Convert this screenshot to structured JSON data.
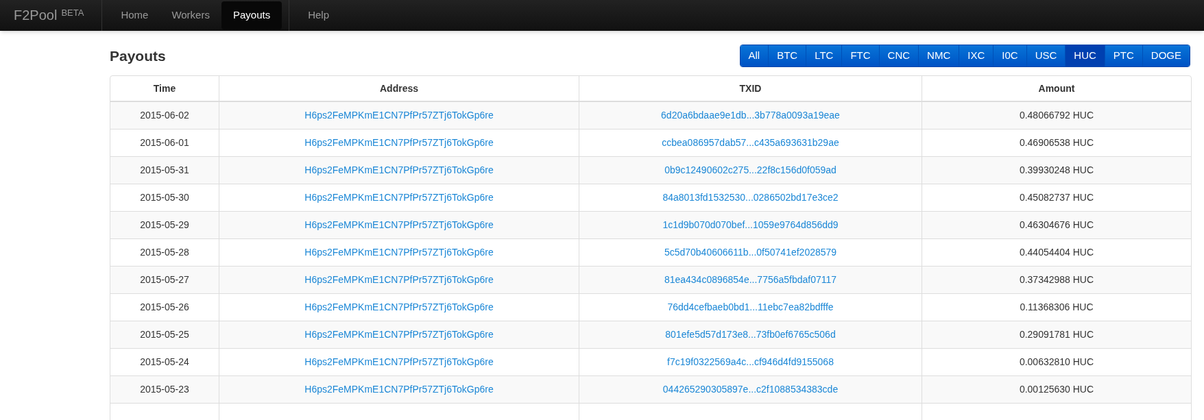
{
  "navbar": {
    "brand": "F2Pool",
    "brand_badge": "BETA",
    "groups": [
      {
        "items": [
          {
            "label": "Home",
            "selected": false
          },
          {
            "label": "Workers",
            "selected": false
          },
          {
            "label": "Payouts",
            "selected": true
          }
        ]
      },
      {
        "items": [
          {
            "label": "Help",
            "selected": false
          }
        ]
      }
    ]
  },
  "page_title": "Payouts",
  "coin_filter": [
    {
      "label": "All",
      "selected": false
    },
    {
      "label": "BTC",
      "selected": false
    },
    {
      "label": "LTC",
      "selected": false
    },
    {
      "label": "FTC",
      "selected": false
    },
    {
      "label": "CNC",
      "selected": false
    },
    {
      "label": "NMC",
      "selected": false
    },
    {
      "label": "IXC",
      "selected": false
    },
    {
      "label": "I0C",
      "selected": false
    },
    {
      "label": "USC",
      "selected": false
    },
    {
      "label": "HUC",
      "selected": true
    },
    {
      "label": "PTC",
      "selected": false
    },
    {
      "label": "DOGE",
      "selected": false
    }
  ],
  "table": {
    "columns": [
      "Time",
      "Address",
      "TXID",
      "Amount"
    ],
    "rows": [
      {
        "time": "2015-06-02",
        "address": "H6ps2FeMPKmE1CN7PfPr57ZTj6TokGp6re",
        "txid": "6d20a6bdaae9e1db...3b778a0093a19eae",
        "amount": "0.48066792 HUC"
      },
      {
        "time": "2015-06-01",
        "address": "H6ps2FeMPKmE1CN7PfPr57ZTj6TokGp6re",
        "txid": "ccbea086957dab57...c435a693631b29ae",
        "amount": "0.46906538 HUC"
      },
      {
        "time": "2015-05-31",
        "address": "H6ps2FeMPKmE1CN7PfPr57ZTj6TokGp6re",
        "txid": "0b9c12490602c275...22f8c156d0f059ad",
        "amount": "0.39930248 HUC"
      },
      {
        "time": "2015-05-30",
        "address": "H6ps2FeMPKmE1CN7PfPr57ZTj6TokGp6re",
        "txid": "84a8013fd1532530...0286502bd17e3ce2",
        "amount": "0.45082737 HUC"
      },
      {
        "time": "2015-05-29",
        "address": "H6ps2FeMPKmE1CN7PfPr57ZTj6TokGp6re",
        "txid": "1c1d9b070d070bef...1059e9764d856dd9",
        "amount": "0.46304676 HUC"
      },
      {
        "time": "2015-05-28",
        "address": "H6ps2FeMPKmE1CN7PfPr57ZTj6TokGp6re",
        "txid": "5c5d70b40606611b...0f50741ef2028579",
        "amount": "0.44054404 HUC"
      },
      {
        "time": "2015-05-27",
        "address": "H6ps2FeMPKmE1CN7PfPr57ZTj6TokGp6re",
        "txid": "81ea434c0896854e...7756a5fbdaf07117",
        "amount": "0.37342988 HUC"
      },
      {
        "time": "2015-05-26",
        "address": "H6ps2FeMPKmE1CN7PfPr57ZTj6TokGp6re",
        "txid": "76dd4cefbaeb0bd1...11ebc7ea82bdfffe",
        "amount": "0.11368306 HUC"
      },
      {
        "time": "2015-05-25",
        "address": "H6ps2FeMPKmE1CN7PfPr57ZTj6TokGp6re",
        "txid": "801efe5d57d173e8...73fb0ef6765c506d",
        "amount": "0.29091781 HUC"
      },
      {
        "time": "2015-05-24",
        "address": "H6ps2FeMPKmE1CN7PfPr57ZTj6TokGp6re",
        "txid": "f7c19f0322569a4c...cf946d4fd9155068",
        "amount": "0.00632810 HUC"
      },
      {
        "time": "2015-05-23",
        "address": "H6ps2FeMPKmE1CN7PfPr57ZTj6TokGp6re",
        "txid": "044265290305897e...c2f1088534383cde",
        "amount": "0.00125630 HUC"
      }
    ]
  }
}
